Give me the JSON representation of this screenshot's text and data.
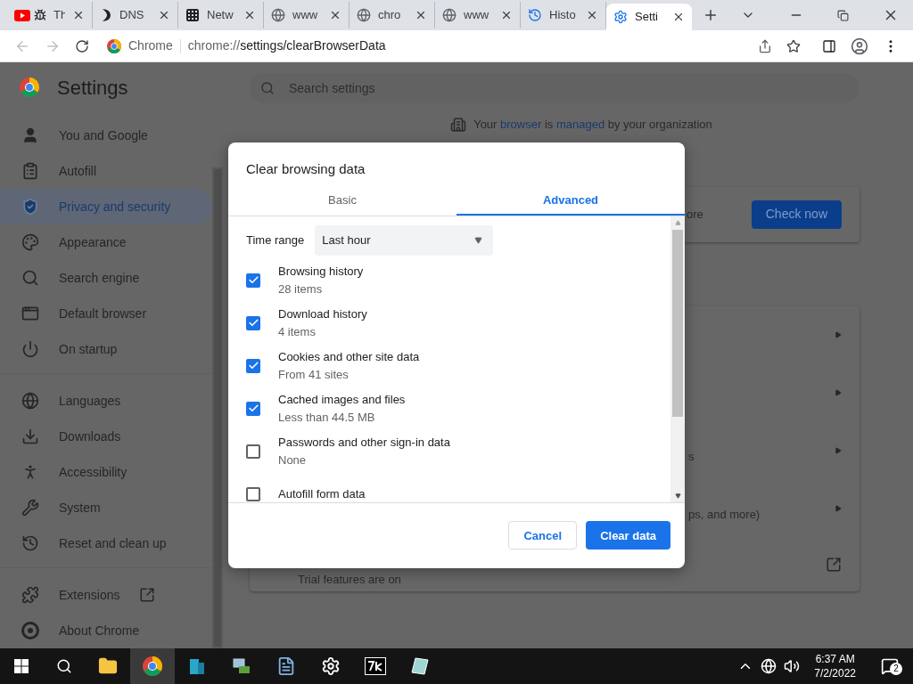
{
  "browser_tabs": [
    {
      "title": "Th",
      "kind": "youtube",
      "selected": false
    },
    {
      "title": "DNS",
      "kind": "dns",
      "selected": false
    },
    {
      "title": "Netw",
      "kind": "grid",
      "selected": false
    },
    {
      "title": "www",
      "kind": "globe",
      "selected": false
    },
    {
      "title": "chro",
      "kind": "globe",
      "selected": false
    },
    {
      "title": "www",
      "kind": "globe",
      "selected": false
    },
    {
      "title": "Histo",
      "kind": "history",
      "selected": false
    },
    {
      "title": "Setti",
      "kind": "gear",
      "selected": true
    }
  ],
  "address_bar": {
    "site_label": "Chrome",
    "url_scheme": "chrome://",
    "url_path": "settings/clearBrowserData"
  },
  "settings": {
    "title": "Settings",
    "search_placeholder": "Search settings",
    "sidebar_groups": [
      [
        {
          "label": "You and Google",
          "selected": false
        },
        {
          "label": "Autofill",
          "selected": false
        },
        {
          "label": "Privacy and security",
          "selected": true
        },
        {
          "label": "Appearance",
          "selected": false
        },
        {
          "label": "Search engine",
          "selected": false
        },
        {
          "label": "Default browser",
          "selected": false
        },
        {
          "label": "On startup",
          "selected": false
        }
      ],
      [
        {
          "label": "Languages",
          "selected": false
        },
        {
          "label": "Downloads",
          "selected": false
        },
        {
          "label": "Accessibility",
          "selected": false
        },
        {
          "label": "System",
          "selected": false
        },
        {
          "label": "Reset and clean up",
          "selected": false
        }
      ],
      [
        {
          "label": "Extensions",
          "selected": false,
          "external": true
        },
        {
          "label": "About Chrome",
          "selected": false
        }
      ]
    ],
    "managed_notice": {
      "before": "Your ",
      "link1": "browser",
      "middle": " is ",
      "link2": "managed",
      "after": " by your organization"
    },
    "safety_card": {
      "partial_text": "ore",
      "button": "Check now"
    },
    "privacy_card": {
      "partial_texts": [
        "s",
        "ps, and more)"
      ],
      "trial_text": "Trial features are on"
    }
  },
  "dialog": {
    "title": "Clear browsing data",
    "tabs": [
      {
        "label": "Basic",
        "selected": false
      },
      {
        "label": "Advanced",
        "selected": true
      }
    ],
    "time_range": {
      "label": "Time range",
      "value": "Last hour"
    },
    "items": [
      {
        "label": "Browsing history",
        "detail": "28 items",
        "checked": true
      },
      {
        "label": "Download history",
        "detail": "4 items",
        "checked": true
      },
      {
        "label": "Cookies and other site data",
        "detail": "From 41 sites",
        "checked": true
      },
      {
        "label": "Cached images and files",
        "detail": "Less than 44.5 MB",
        "checked": true
      },
      {
        "label": "Passwords and other sign-in data",
        "detail": "None",
        "checked": false
      },
      {
        "label": "Autofill form data",
        "checked": false
      }
    ],
    "buttons": [
      {
        "label": "Cancel",
        "kind": "secondary"
      },
      {
        "label": "Clear data",
        "kind": "primary"
      }
    ]
  },
  "taskbar": {
    "time": "6:37 AM",
    "date": "7/2/2022",
    "notification_count": "2"
  }
}
